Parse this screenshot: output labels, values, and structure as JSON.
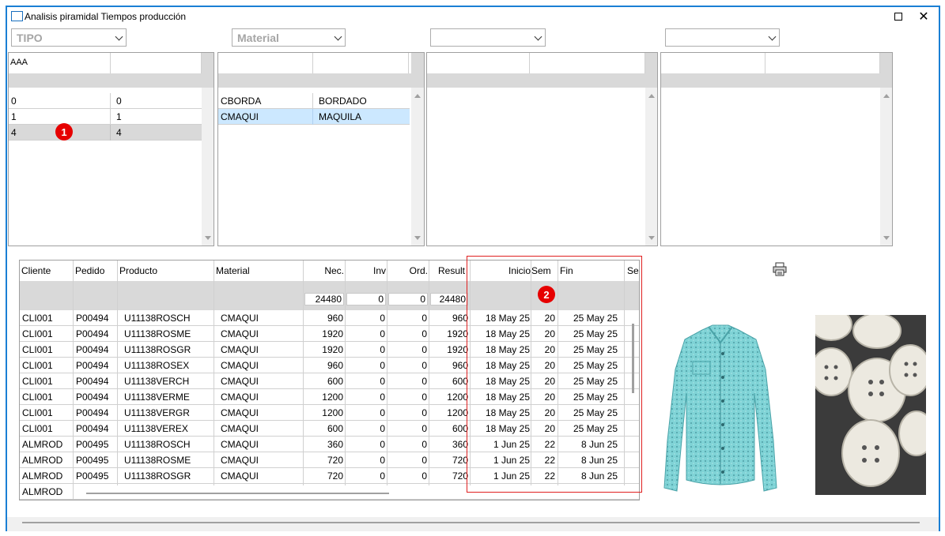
{
  "window": {
    "title": "Analisis piramidal  Tiempos producción"
  },
  "filters": [
    {
      "value": "TIPO"
    },
    {
      "value": "Material"
    },
    {
      "value": ""
    },
    {
      "value": ""
    }
  ],
  "panel_tipo": {
    "header": "AAA",
    "rows": [
      {
        "c1": "0",
        "c2": "0"
      },
      {
        "c1": "1",
        "c2": "1"
      },
      {
        "c1": "4",
        "c2": "4"
      }
    ],
    "badge": "1"
  },
  "panel_material": {
    "rows": [
      {
        "c1": "CBORDA",
        "c2": "BORDADO"
      },
      {
        "c1": "CMAQUI",
        "c2": "MAQUILA"
      }
    ]
  },
  "grid": {
    "columns": [
      "Cliente",
      "Pedido",
      "Producto",
      "Material",
      "Nec.",
      "Inv",
      "Ord.",
      "Result",
      "Inicio",
      "Sem",
      "Fin",
      "Se"
    ],
    "totals": {
      "nec": "24480",
      "inv": "0",
      "ord": "0",
      "result": "24480"
    },
    "badge": "2",
    "rows": [
      {
        "cliente": "CLI001",
        "pedido": "P00494",
        "producto": "U11138ROSCH",
        "material": "CMAQUI",
        "nec": "960",
        "inv": "0",
        "ord": "0",
        "result": "960",
        "inicio": "18 May 25",
        "sem": "20",
        "fin": "25 May 25"
      },
      {
        "cliente": "CLI001",
        "pedido": "P00494",
        "producto": "U11138ROSME",
        "material": "CMAQUI",
        "nec": "1920",
        "inv": "0",
        "ord": "0",
        "result": "1920",
        "inicio": "18 May 25",
        "sem": "20",
        "fin": "25 May 25"
      },
      {
        "cliente": "CLI001",
        "pedido": "P00494",
        "producto": "U11138ROSGR",
        "material": "CMAQUI",
        "nec": "1920",
        "inv": "0",
        "ord": "0",
        "result": "1920",
        "inicio": "18 May 25",
        "sem": "20",
        "fin": "25 May 25"
      },
      {
        "cliente": "CLI001",
        "pedido": "P00494",
        "producto": "U11138ROSEX",
        "material": "CMAQUI",
        "nec": "960",
        "inv": "0",
        "ord": "0",
        "result": "960",
        "inicio": "18 May 25",
        "sem": "20",
        "fin": "25 May 25"
      },
      {
        "cliente": "CLI001",
        "pedido": "P00494",
        "producto": "U11138VERCH",
        "material": "CMAQUI",
        "nec": "600",
        "inv": "0",
        "ord": "0",
        "result": "600",
        "inicio": "18 May 25",
        "sem": "20",
        "fin": "25 May 25"
      },
      {
        "cliente": "CLI001",
        "pedido": "P00494",
        "producto": "U11138VERME",
        "material": "CMAQUI",
        "nec": "1200",
        "inv": "0",
        "ord": "0",
        "result": "1200",
        "inicio": "18 May 25",
        "sem": "20",
        "fin": "25 May 25"
      },
      {
        "cliente": "CLI001",
        "pedido": "P00494",
        "producto": "U11138VERGR",
        "material": "CMAQUI",
        "nec": "1200",
        "inv": "0",
        "ord": "0",
        "result": "1200",
        "inicio": "18 May 25",
        "sem": "20",
        "fin": "25 May 25"
      },
      {
        "cliente": "CLI001",
        "pedido": "P00494",
        "producto": "U11138VEREX",
        "material": "CMAQUI",
        "nec": "600",
        "inv": "0",
        "ord": "0",
        "result": "600",
        "inicio": "18 May 25",
        "sem": "20",
        "fin": "25 May 25"
      },
      {
        "cliente": "ALMROD",
        "pedido": "P00495",
        "producto": "U11138ROSCH",
        "material": "CMAQUI",
        "nec": "360",
        "inv": "0",
        "ord": "0",
        "result": "360",
        "inicio": "1 Jun 25",
        "sem": "22",
        "fin": "8 Jun 25"
      },
      {
        "cliente": "ALMROD",
        "pedido": "P00495",
        "producto": "U11138ROSME",
        "material": "CMAQUI",
        "nec": "720",
        "inv": "0",
        "ord": "0",
        "result": "720",
        "inicio": "1 Jun 25",
        "sem": "22",
        "fin": "8 Jun 25"
      },
      {
        "cliente": "ALMROD",
        "pedido": "P00495",
        "producto": "U11138ROSGR",
        "material": "CMAQUI",
        "nec": "720",
        "inv": "0",
        "ord": "0",
        "result": "720",
        "inicio": "1 Jun 25",
        "sem": "22",
        "fin": "8 Jun 25"
      },
      {
        "cliente": "ALMROD",
        "pedido": "",
        "producto": "",
        "material": "",
        "nec": "",
        "inv": "",
        "ord": "",
        "result": "",
        "inicio": "",
        "sem": "",
        "fin": ""
      }
    ]
  },
  "icons": {
    "print": "print-icon",
    "close": "close-icon",
    "maximize": "maximize-icon"
  }
}
